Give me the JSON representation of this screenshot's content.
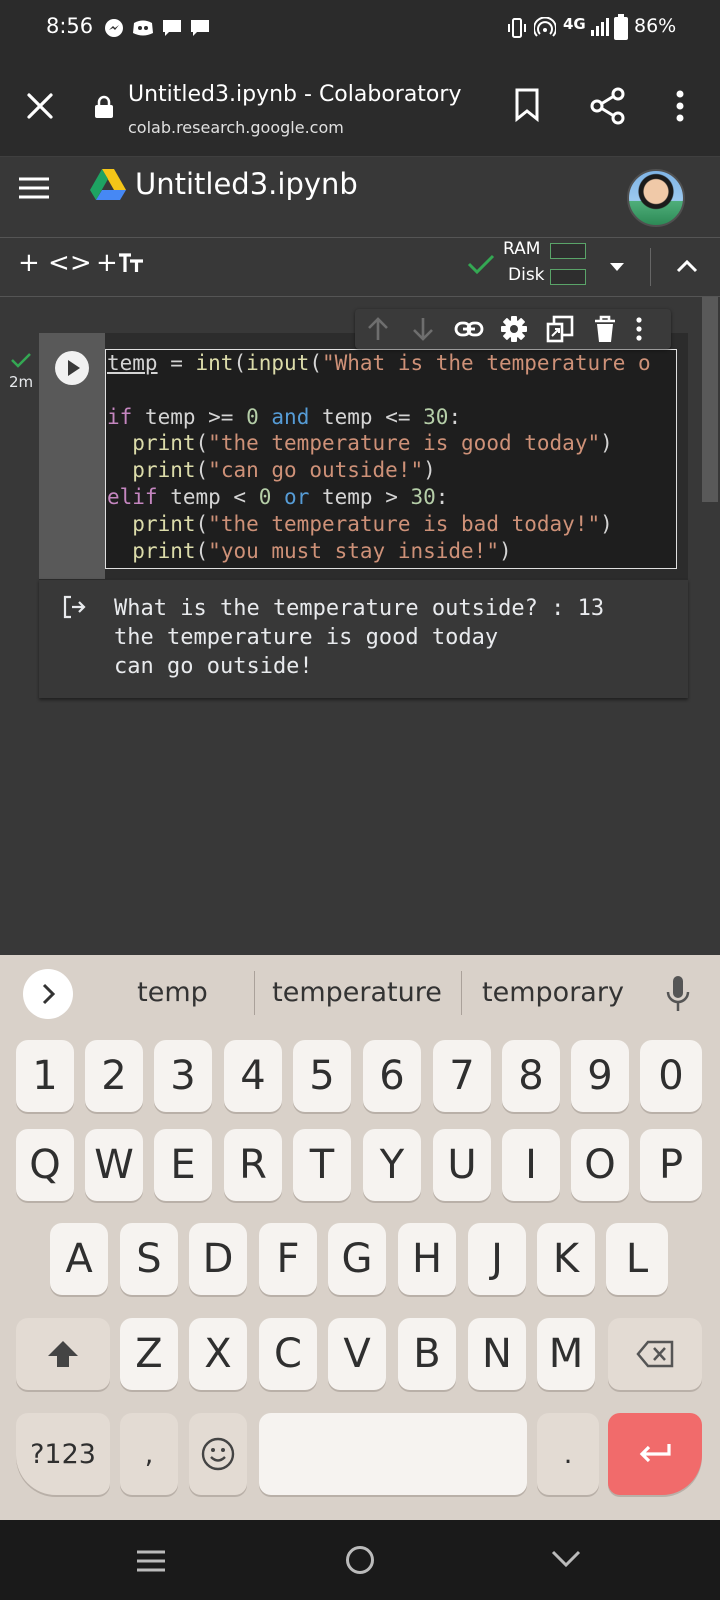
{
  "status_bar": {
    "time": "8:56",
    "network": "4G",
    "battery": "86%"
  },
  "browser": {
    "page_title": "Untitled3.ipynb - Colaboratory",
    "url": "colab.research.google.com"
  },
  "colab": {
    "notebook_name": "Untitled3.ipynb"
  },
  "toolbar": {
    "add_code": "+ <>",
    "add_text": "+ ",
    "ram_label": "RAM",
    "disk_label": "Disk"
  },
  "cell": {
    "exec_status": "2m",
    "output_lines": [
      "What is the temperature outside? : 13",
      "the temperature is good today",
      "can go outside!"
    ]
  },
  "keyboard": {
    "suggestions": [
      "temp",
      "temperature",
      "temporary"
    ],
    "number_row": [
      "1",
      "2",
      "3",
      "4",
      "5",
      "6",
      "7",
      "8",
      "9",
      "0"
    ],
    "row1": [
      "Q",
      "W",
      "E",
      "R",
      "T",
      "Y",
      "U",
      "I",
      "O",
      "P"
    ],
    "row2": [
      "A",
      "S",
      "D",
      "F",
      "G",
      "H",
      "J",
      "K",
      "L"
    ],
    "row3": [
      "Z",
      "X",
      "C",
      "V",
      "B",
      "N",
      "M"
    ],
    "symbols_key": "?123",
    "comma_key": ",",
    "period_key": "."
  }
}
